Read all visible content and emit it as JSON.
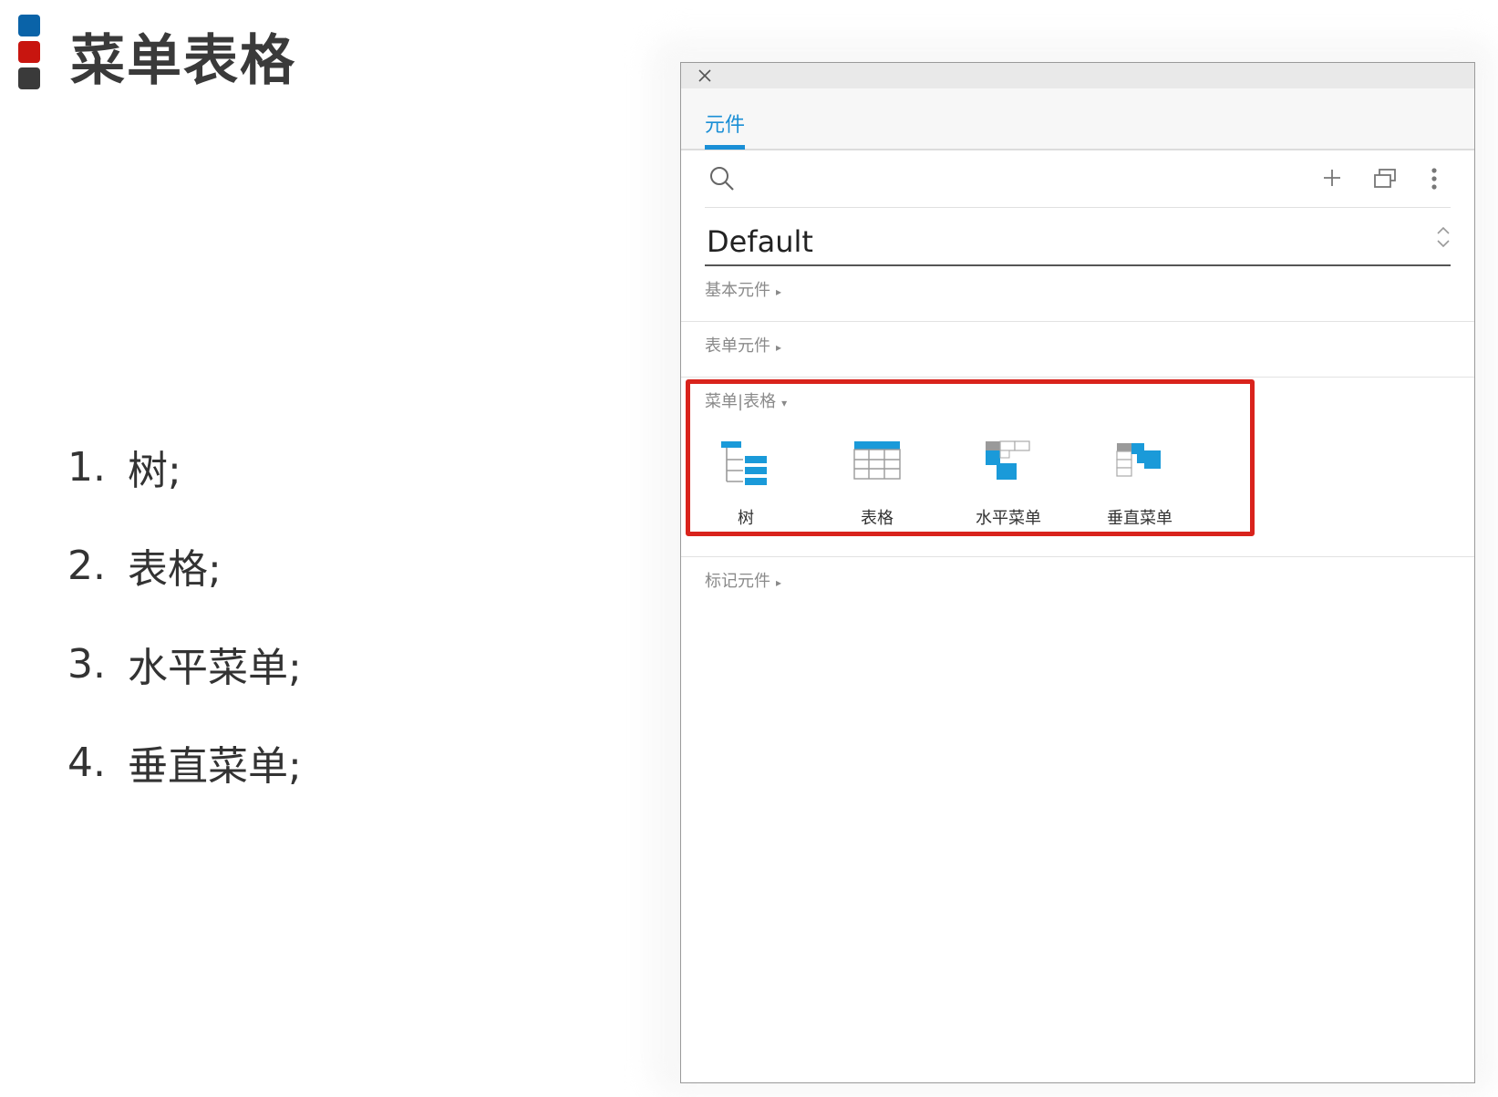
{
  "slide": {
    "title": "菜单表格",
    "title_bar_colors": [
      "#0a63a8",
      "#c8150f",
      "#3a3a3a"
    ],
    "steps": [
      {
        "num": "1.",
        "text": "树;"
      },
      {
        "num": "2.",
        "text": "表格;"
      },
      {
        "num": "3.",
        "text": "水平菜单;"
      },
      {
        "num": "4.",
        "text": "垂直菜单;"
      }
    ]
  },
  "panel": {
    "close_icon": "close-icon",
    "tab_label": "元件",
    "toolbar_icons": [
      "search-icon",
      "plus-icon",
      "windows-icon",
      "more-icon"
    ],
    "library_value": "Default",
    "sections": [
      {
        "label": "基本元件",
        "arrow": "▸",
        "open": false
      },
      {
        "label": "表单元件",
        "arrow": "▸",
        "open": false
      },
      {
        "label": "菜单|表格",
        "arrow": "▾",
        "open": true
      },
      {
        "label": "标记元件",
        "arrow": "▸",
        "open": false
      }
    ],
    "widgets": [
      {
        "label": "树",
        "icon": "tree-icon"
      },
      {
        "label": "表格",
        "icon": "table-icon"
      },
      {
        "label": "水平菜单",
        "icon": "horizontal-menu-icon"
      },
      {
        "label": "垂直菜单",
        "icon": "vertical-menu-icon"
      }
    ],
    "accent_color": "#1a8fd6",
    "highlight_color": "#d9231c"
  }
}
